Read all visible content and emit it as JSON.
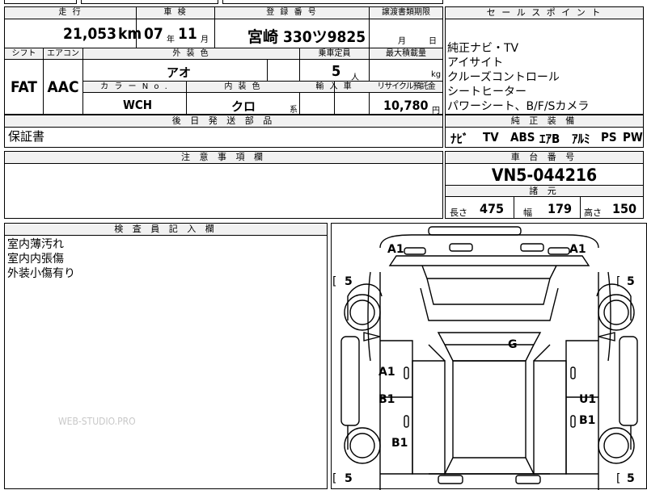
{
  "mileage": {
    "label": "走 行",
    "value": "21,053",
    "unit": "km"
  },
  "inspection": {
    "label": "車 検",
    "year": "07",
    "year_unit": "年",
    "month": "11",
    "month_unit": "月"
  },
  "registration": {
    "label": "登 録 番 号",
    "value": "宮崎 330ツ9825"
  },
  "transfer": {
    "label": "譲渡書類期限",
    "month_unit": "月",
    "day_unit": "日"
  },
  "sales_points": {
    "label": "セ ー ル ス ポ イ ン ト",
    "items": [
      "純正ナビ・TV",
      "アイサイト",
      "クルーズコントロール",
      "シートヒーター",
      "パワーシート、B/F/Sカメラ"
    ]
  },
  "shift": {
    "label": "シフト",
    "value": "FAT"
  },
  "aircon": {
    "label": "エアコン",
    "value": "AAC"
  },
  "exterior_color": {
    "label": "外 装 色",
    "value": "アオ"
  },
  "capacity": {
    "label": "乗車定員",
    "value": "5",
    "unit": "人"
  },
  "max_load": {
    "label": "最大積載量",
    "unit": "kg"
  },
  "color_no": {
    "label": "カ ラ ー N o .",
    "value": "WCH"
  },
  "interior_color": {
    "label": "内 装 色",
    "value": "クロ",
    "suffix": "系"
  },
  "import": {
    "label": "輸 入 車"
  },
  "recycle": {
    "label": "リサイクル預託金",
    "value": "10,780",
    "unit": "円"
  },
  "later_parts": {
    "label": "後 日 発 送 部 品",
    "value": "保証書"
  },
  "genuine_equipment": {
    "label": "純 正 装 備",
    "items": [
      "ﾅﾋﾞ",
      "TV",
      "ABS",
      "ｴｱB",
      "ｱﾙﾐ",
      "PS",
      "PW"
    ]
  },
  "notes": {
    "label": "注 意 事 項 欄"
  },
  "chassis": {
    "label": "車 台 番 号",
    "value": "VN5-044216"
  },
  "dimensions": {
    "label": "諸 元",
    "length_label": "長さ",
    "length": "475",
    "width_label": "幅",
    "width": "179",
    "height_label": "高さ",
    "height": "150"
  },
  "inspector": {
    "label": "検 査 員 記 入 欄",
    "lines": [
      "室内薄汚れ",
      "室内内張傷",
      "外装小傷有り"
    ]
  },
  "watermark": "WEB-STUDIO.PRO",
  "diagram": {
    "front_left": "A1",
    "front_right": "A1",
    "tire_fl": "5",
    "tire_fr": "5",
    "tire_rl": "5",
    "tire_rr": "5",
    "bracket_open": "[",
    "bracket_close": "",
    "glass": "G",
    "door_fl": "A1",
    "door_rl": "B1",
    "door_fr": "U1",
    "door_rr": "B1",
    "rear_left": "B1"
  }
}
